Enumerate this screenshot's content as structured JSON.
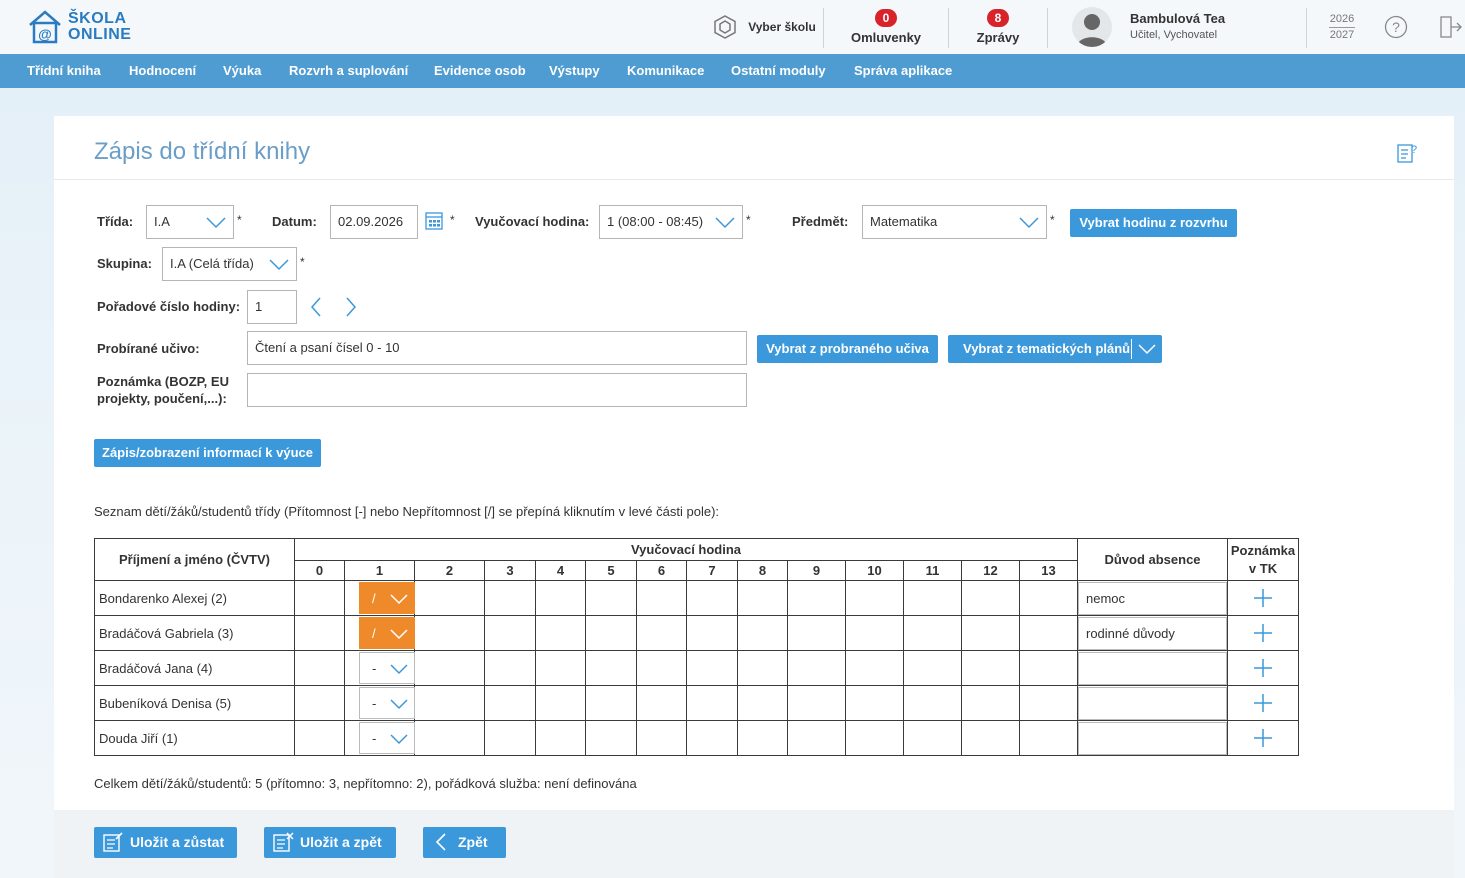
{
  "header": {
    "logo_line1": "ŠKOLA",
    "logo_line2": "ONLINE",
    "school_select_label": "Vyber školu",
    "excuses": {
      "count": "0",
      "label": "Omluvenky"
    },
    "messages": {
      "count": "8",
      "label": "Zprávy"
    },
    "user": {
      "name": "Bambulová Tea",
      "role": "Učitel, Vychovatel"
    },
    "year_from": "2026",
    "year_to": "2027",
    "icons": {
      "help": "help-circle-icon",
      "logout": "logout-icon"
    }
  },
  "nav": {
    "items": [
      "Třídní kniha",
      "Hodnocení",
      "Výuka",
      "Rozvrh a suplování",
      "Evidence osob",
      "Výstupy",
      "Komunikace",
      "Ostatní moduly",
      "Správa aplikace"
    ]
  },
  "page": {
    "title": "Zápis do třídní knihy"
  },
  "form": {
    "class_label": "Třída:",
    "class_value": "I.A",
    "date_label": "Datum:",
    "date_value": "02.09.2026",
    "lesson_label": "Vyučovací hodina:",
    "lesson_value": "1 (08:00 - 08:45)",
    "subject_label": "Předmět:",
    "subject_value": "Matematika",
    "pick_from_schedule": "Vybrat hodinu z rozvrhu",
    "group_label": "Skupina:",
    "group_value": "I.A (Celá třída)",
    "lesson_number_label": "Pořadové číslo hodiny:",
    "lesson_number_value": "1",
    "topic_label": "Probírané učivo:",
    "topic_value": "Čtení a psaní čísel 0 - 10",
    "pick_from_topics": "Vybrat z probraného učiva",
    "pick_from_plans": "Vybrat z tematických plánů",
    "note_label": "Poznámka (BOZP, EU projekty, poučení,...):",
    "note_value": "",
    "lesson_info_button": "Zápis/zobrazení informací k výuce",
    "required_mark": "*"
  },
  "attendance": {
    "caption": "Seznam dětí/žáků/studentů třídy (Přítomnost [-] nebo Nepřítomnost [/] se přepíná kliknutím v levé části pole):",
    "col_name": "Příjmení a jméno (ČVTV)",
    "col_hours": "Vyučovací hodina",
    "hours": [
      "0",
      "1",
      "2",
      "3",
      "4",
      "5",
      "6",
      "7",
      "8",
      "9",
      "10",
      "11",
      "12",
      "13"
    ],
    "col_reason": "Důvod absence",
    "col_note": "Poznámka v TK",
    "rows": [
      {
        "name": "Bondarenko Alexej (2)",
        "hour1": "/",
        "absent": true,
        "reason": "nemoc"
      },
      {
        "name": "Bradáčová Gabriela (3)",
        "hour1": "/",
        "absent": true,
        "reason": "rodinné důvody"
      },
      {
        "name": "Bradáčová Jana (4)",
        "hour1": "-",
        "absent": false,
        "reason": ""
      },
      {
        "name": "Bubeníková Denisa (5)",
        "hour1": "-",
        "absent": false,
        "reason": ""
      },
      {
        "name": "Douda Jiří (1)",
        "hour1": "-",
        "absent": false,
        "reason": ""
      }
    ],
    "summary": "Celkem dětí/žáků/studentů: 5 (přítomno: 3, nepřítomno: 2), pořádková služba: není definována",
    "absent_color": "#ef8a2a"
  },
  "footer": {
    "save_stay": "Uložit a zůstat",
    "save_back": "Uložit a zpět",
    "back": "Zpět"
  },
  "colors": {
    "accent": "#3a98db",
    "nav": "#4f9cd2",
    "title": "#6a9ec9",
    "badge": "#d8232a"
  }
}
